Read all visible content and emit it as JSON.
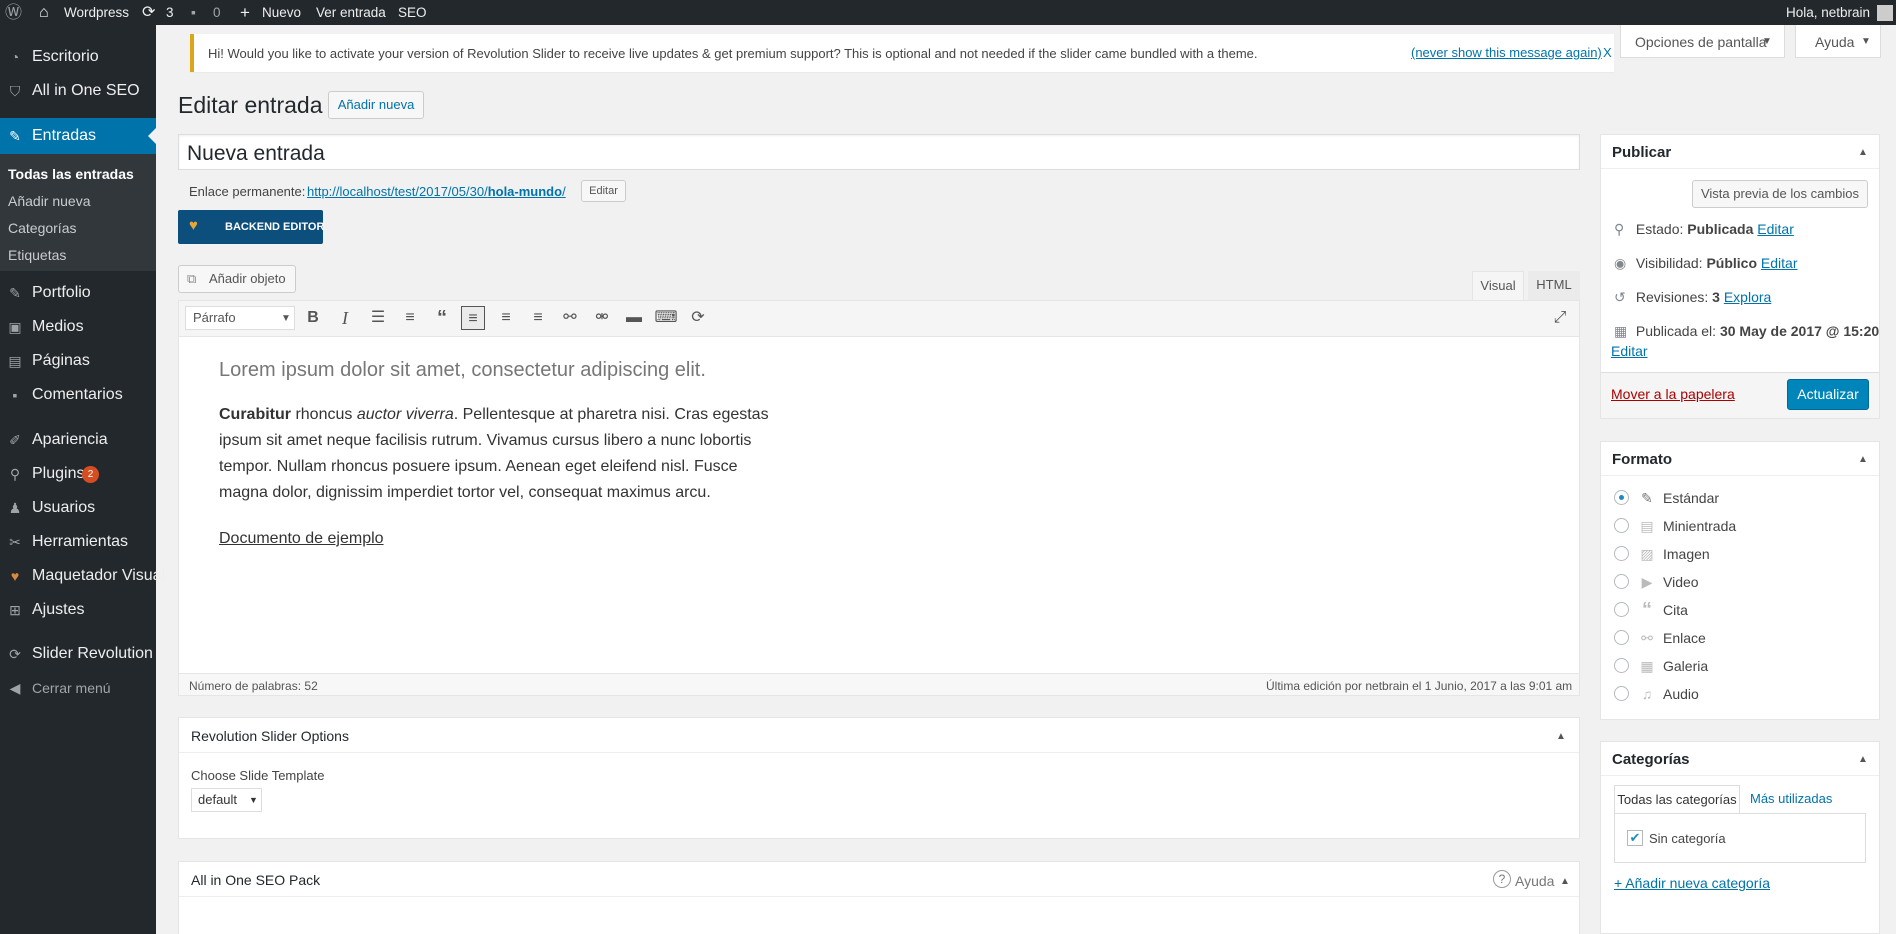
{
  "adminbar": {
    "site_name": "Wordpress",
    "updates_count": "3",
    "comments_count": "0",
    "new_label": "Nuevo",
    "view_post": "Ver entrada",
    "seo": "SEO",
    "greeting": "Hola, netbrain"
  },
  "sidebar": {
    "items": [
      {
        "label": "Escritorio",
        "icon": "dashboard-icon"
      },
      {
        "label": "All in One SEO",
        "icon": "seo-shield-icon"
      },
      {
        "label": "Entradas",
        "icon": "pushpin-icon"
      },
      {
        "label": "Portfolio",
        "icon": "portfolio-icon"
      },
      {
        "label": "Medios",
        "icon": "media-icon"
      },
      {
        "label": "Páginas",
        "icon": "pages-icon"
      },
      {
        "label": "Comentarios",
        "icon": "comments-icon"
      },
      {
        "label": "Apariencia",
        "icon": "brush-icon"
      },
      {
        "label": "Plugins",
        "icon": "plugin-icon",
        "badge": "2"
      },
      {
        "label": "Usuarios",
        "icon": "user-icon"
      },
      {
        "label": "Herramientas",
        "icon": "wrench-icon"
      },
      {
        "label": "Maquetador Visual",
        "icon": "visual-composer-icon"
      },
      {
        "label": "Ajustes",
        "icon": "settings-icon"
      },
      {
        "label": "Slider Revolution",
        "icon": "refresh-icon"
      },
      {
        "label": "Cerrar menú",
        "icon": "collapse-icon"
      }
    ],
    "submenu": [
      "Todas las entradas",
      "Añadir nueva",
      "Categorías",
      "Etiquetas"
    ]
  },
  "notice": {
    "text": "Hi! Would you like to activate your version of Revolution Slider to receive live updates & get premium support? This is optional and not needed if the slider came bundled with a theme.",
    "dismiss": "(never show this message again)",
    "close": "X"
  },
  "screen_options": "Opciones de pantalla",
  "help": "Ayuda",
  "page": {
    "title": "Editar entrada",
    "add_new": "Añadir nueva",
    "post_title": "Nueva entrada",
    "permalink_label": "Enlace permanente:",
    "permalink_base": "http://localhost/test/2017/05/30/",
    "permalink_slug": "hola-mundo",
    "permalink_end": "/",
    "permalink_edit": "Editar",
    "backend_editor": "BACKEND EDITOR",
    "add_media": "Añadir objeto",
    "tab_visual": "Visual",
    "tab_html": "HTML"
  },
  "editor": {
    "format_select": "Párrafo",
    "heading": "Lorem ipsum dolor sit amet, consectetur adipiscing elit.",
    "p_bold": "Curabitur",
    "p_after_bold": " rhoncus ",
    "p_italic": "auctor viverra",
    "p_line1_rest": ". Pellentesque at pharetra nisi. Cras egestas",
    "p_line2": "ipsum sit amet neque facilisis rutrum. Vivamus cursus libero a nunc lobortis",
    "p_line3": "tempor. Nullam rhoncus posuere ipsum. Aenean eget eleifend nisl. Fusce",
    "p_line4": "magna dolor, dignissim imperdiet tortor vel, consequat maximus arcu.",
    "link": "Documento de ejemplo",
    "word_count": "Número de palabras: 52",
    "last_edit": "Última edición por netbrain el 1 Junio, 2017 a las 9:01 am"
  },
  "revslider": {
    "title": "Revolution Slider Options",
    "label": "Choose Slide Template",
    "select": "default"
  },
  "aioseo": {
    "title": "All in One SEO Pack",
    "help": "Ayuda"
  },
  "publish": {
    "title": "Publicar",
    "preview": "Vista previa de los cambios",
    "status_label": "Estado:",
    "status_value": "Publicada",
    "visibility_label": "Visibilidad:",
    "visibility_value": "Público",
    "revisions_label": "Revisiones:",
    "revisions_value": "3",
    "revisions_link": "Explora",
    "published_label": "Publicada el:",
    "published_value": "30 May de 2017 @ 15:20",
    "edit": "Editar",
    "trash": "Mover a la papelera",
    "update": "Actualizar"
  },
  "format": {
    "title": "Formato",
    "options": [
      {
        "label": "Estándar",
        "icon": "pushpin-icon",
        "selected": true
      },
      {
        "label": "Minientrada",
        "icon": "aside-icon"
      },
      {
        "label": "Imagen",
        "icon": "image-icon"
      },
      {
        "label": "Video",
        "icon": "video-icon"
      },
      {
        "label": "Cita",
        "icon": "quote-icon"
      },
      {
        "label": "Enlace",
        "icon": "link-icon"
      },
      {
        "label": "Galeria",
        "icon": "gallery-icon"
      },
      {
        "label": "Audio",
        "icon": "audio-icon"
      }
    ]
  },
  "categories": {
    "title": "Categorías",
    "tab_all": "Todas las categorías",
    "tab_popular": "Más utilizadas",
    "item": "Sin categoría",
    "add_new": "+ Añadir nueva categoría"
  },
  "colors": {
    "adminbar": "#23282d",
    "accent": "#0073aa",
    "update_button": "#0085ba",
    "plugin_badge": "#d54e21"
  }
}
